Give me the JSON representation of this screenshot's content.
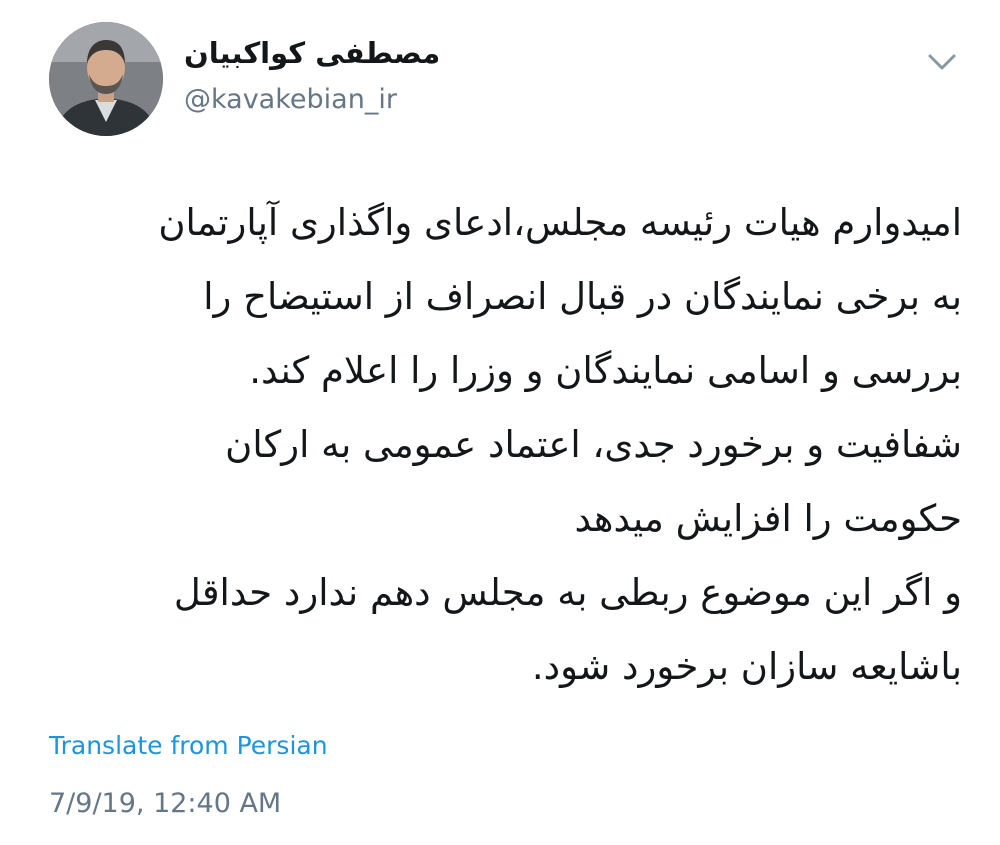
{
  "author": {
    "display_name": "مصطفی کواکبیان",
    "handle": "@kavakebian_ir"
  },
  "tweet": {
    "lines": [
      "امیدوارم هیات رئیسه مجلس،ادعای واگذاری آپارتمان",
      "به برخی نمایندگان در قبال انصراف از استیضاح را",
      "بررسی و اسامی نمایندگان و وزرا را اعلام کند.",
      "شفافیت و برخورد جدی، اعتماد عمومی به ارکان",
      "حکومت را افزایش میدهد",
      "و اگر این موضوع ربطی به مجلس دهم ندارد حداقل",
      "باشایعه سازان برخورد شود."
    ],
    "translate_label": "Translate from Persian",
    "timestamp": "7/9/19, 12:40 AM"
  },
  "icons": {
    "avatar": "profile-photo",
    "menu": "chevron-down-icon"
  },
  "colors": {
    "text": "#14171a",
    "secondary": "#657786",
    "link": "#1b95e0",
    "caret": "#8899a6"
  }
}
